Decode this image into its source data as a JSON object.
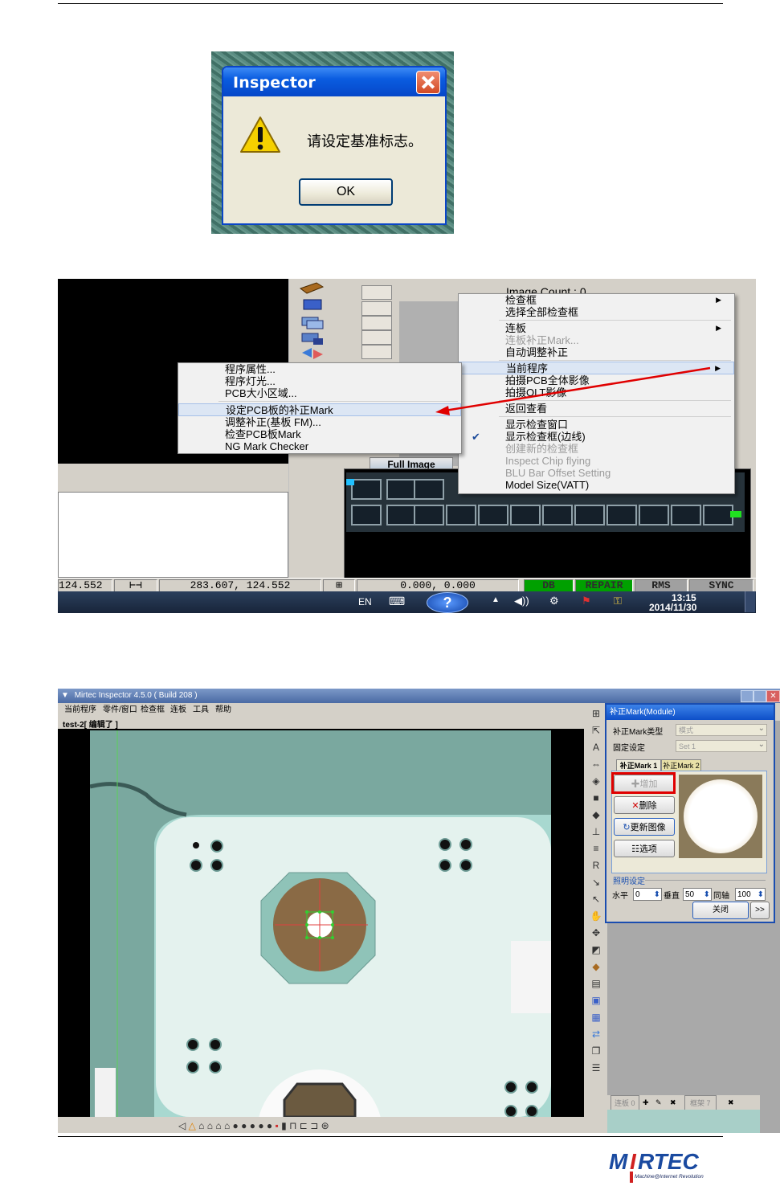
{
  "message_box": {
    "title": "Inspector",
    "message": "请设定基准标志。",
    "ok_label": "OK"
  },
  "screenshot2": {
    "image_count_label": "Image Count : 0",
    "full_image_tab": "Full Image",
    "main_menu": [
      {
        "label": "检查框",
        "submenu": true,
        "disabled": false
      },
      {
        "label": "选择全部检查框",
        "submenu": false,
        "disabled": false
      },
      {
        "label": "连板",
        "submenu": true,
        "disabled": false
      },
      {
        "label": "连板补正Mark...",
        "submenu": false,
        "disabled": true
      },
      {
        "label": "自动调整补正",
        "submenu": false,
        "disabled": false
      },
      {
        "label": "当前程序",
        "submenu": true,
        "disabled": false,
        "highlighted": true
      },
      {
        "label": "拍摄PCB全体影像",
        "submenu": false,
        "disabled": false
      },
      {
        "label": "拍摄OLT影像",
        "submenu": false,
        "disabled": false
      },
      {
        "label": "返回查看",
        "submenu": false,
        "disabled": false
      },
      {
        "label": "显示检查窗口",
        "submenu": false,
        "disabled": false
      },
      {
        "label": "显示检查框(边线)",
        "submenu": false,
        "disabled": false,
        "checked": true
      },
      {
        "label": "创建新的检查框",
        "submenu": false,
        "disabled": true
      },
      {
        "label": "Inspect Chip flying",
        "submenu": false,
        "disabled": true
      },
      {
        "label": "BLU Bar Offset Setting",
        "submenu": false,
        "disabled": true
      },
      {
        "label": "Model Size(VATT)",
        "submenu": false,
        "disabled": false
      }
    ],
    "sub_menu": [
      {
        "label": "程序属性..."
      },
      {
        "label": "程序灯光..."
      },
      {
        "label": "PCB大小区域..."
      },
      {
        "label": "设定PCB板的补正Mark",
        "highlighted": true
      },
      {
        "label": "调整补正(基板 FM)..."
      },
      {
        "label": "检查PCB板Mark"
      },
      {
        "label": "NG Mark Checker"
      }
    ],
    "status": {
      "coord1": "124.552",
      "coord2": "283.607, 124.552",
      "coord3": "0.000, 0.000",
      "db": "DB",
      "repair": "REPAIR",
      "rms": "RMS",
      "sync": "SYNC"
    },
    "taskbar": {
      "lang": "EN",
      "time": "13:15",
      "date": "2014/11/30"
    },
    "arrow_color": "#e00000"
  },
  "screenshot3": {
    "app_title": "Mirtec Inspector 4.5.0 ( Build 208 )",
    "menus": [
      "当前程序",
      "零件/窗口",
      "检查框",
      "连板",
      "工具",
      "帮助"
    ],
    "doc_title": "test-2[ 编辑了 ]",
    "dialog": {
      "title": "补正Mark(Module)",
      "type_label": "补正Mark类型",
      "type_value": "模式",
      "fixed_label": "固定设定",
      "fixed_value": "Set 1",
      "tab1": "补正Mark 1",
      "tab2": "补正Mark 2",
      "add_btn": "增加",
      "delete_btn": "删除",
      "update_btn": "更新图像",
      "options_btn": "选项",
      "light_section": "照明设定",
      "horizontal_label": "水平",
      "horizontal_value": "0",
      "vertical_label": "垂直",
      "vertical_value": "50",
      "coaxial_label": "同轴",
      "coaxial_value": "100",
      "close_btn": "关闭",
      "more_btn": ">>"
    },
    "panel_bottom": {
      "array_label": "连板 0",
      "frame_label": "框架 7"
    },
    "highlight_color": "#e00000"
  },
  "logo": {
    "text": "MIRTEC",
    "tagline": "Machine@Internet Revolution"
  }
}
